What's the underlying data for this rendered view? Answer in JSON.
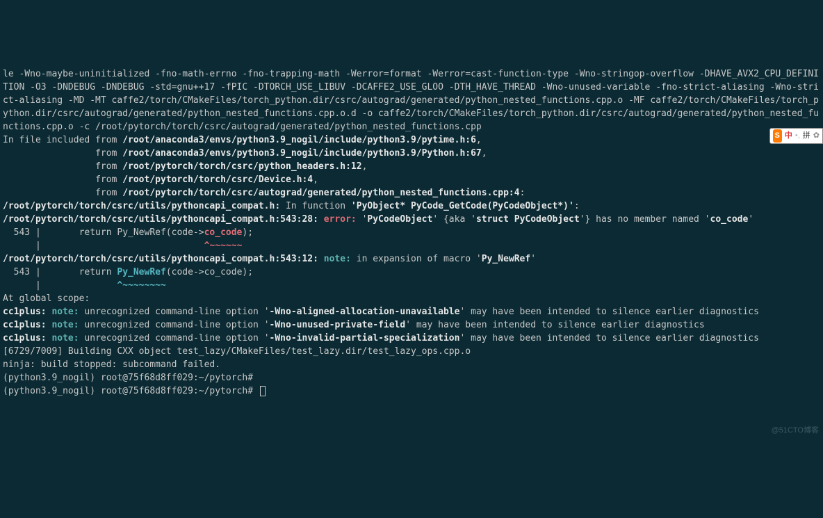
{
  "compile_flags": "le -Wno-maybe-uninitialized -fno-math-errno -fno-trapping-math -Werror=format -Werror=cast-function-type -Wno-stringop-overflow -DHAVE_AVX2_CPU_DEFINITION -O3 -DNDEBUG -DNDEBUG -std=gnu++17 -fPIC -DTORCH_USE_LIBUV -DCAFFE2_USE_GLOO -DTH_HAVE_THREAD -Wno-unused-variable -fno-strict-aliasing -Wno-strict-aliasing -MD -MT caffe2/torch/CMakeFiles/torch_python.dir/csrc/autograd/generated/python_nested_functions.cpp.o -MF caffe2/torch/CMakeFiles/torch_python.dir/csrc/autograd/generated/python_nested_functions.cpp.o.d -o caffe2/torch/CMakeFiles/torch_python.dir/csrc/autograd/generated/python_nested_functions.cpp.o -c /root/pytorch/torch/csrc/autograd/generated/python_nested_functions.cpp",
  "inc0_pre": "In file included from ",
  "inc0_path": "/root/anaconda3/envs/python3.9_nogil/include/python3.9/pytime.h:6",
  "inc_from": "                 from ",
  "inc1_path": "/root/anaconda3/envs/python3.9_nogil/include/python3.9/Python.h:67",
  "inc2_path": "/root/pytorch/torch/csrc/python_headers.h:12",
  "inc3_path": "/root/pytorch/torch/csrc/Device.h:4",
  "inc4_path": "/root/pytorch/torch/csrc/autograd/generated/python_nested_functions.cpp:4",
  "inc_colon": ":",
  "inc_comma": ",",
  "loc1_file": "/root/pytorch/torch/csrc/utils/pythoncapi_compat.h:",
  "loc1_infunc": " In function ",
  "loc1_sig": "'PyObject* PyCode_GetCode(PyCodeObject*)'",
  "err_file": "/root/pytorch/torch/csrc/utils/pythoncapi_compat.h:543:28:",
  "err_tag": " error: ",
  "err_msg1": "'",
  "err_type1": "PyCodeObject",
  "err_msg2": "' {aka '",
  "err_type2": "struct PyCodeObject",
  "err_msg3": "'} has no member named '",
  "err_member": "co_code",
  "err_msg4": "'",
  "code_ln": "  543 |       return Py_NewRef(code->",
  "code_mem": "co_code",
  "code_end": ");",
  "caret1": "      |                              ",
  "caret1b": "^~~~~~~",
  "note_file": "/root/pytorch/torch/csrc/utils/pythoncapi_compat.h:543:12:",
  "note_tag": " note: ",
  "note_msg": "in expansion of macro '",
  "note_macro": "Py_NewRef",
  "note_msg2": "'",
  "code2_ln": "  543 |       return ",
  "code2_macro": "Py_NewRef",
  "code2_rest": "(code->co_code);",
  "caret2": "      |              ",
  "caret2b": "^~~~~~~~~",
  "global_scope": "At global scope:",
  "cc1": "cc1plus: ",
  "cc_note": "note:",
  "cc_msg1a": " unrecognized command-line option '",
  "cc_opt1": "-Wno-aligned-allocation-unavailable",
  "cc_msg1b": "' may have been intended to silence earlier diagnostics",
  "cc_opt2": "-Wno-unused-private-field",
  "cc_opt3": "-Wno-invalid-partial-specialization",
  "build_line": "[6729/7009] Building CXX object test_lazy/CMakeFiles/test_lazy.dir/test_lazy_ops.cpp.o",
  "ninja": "ninja: build stopped: subcommand failed.",
  "prompt": "(python3.9_nogil) root@75f68d8ff029:~/pytorch#",
  "ime_s": "S",
  "ime_cn": "中",
  "ime_sep": "•,",
  "ime_pin": "拼",
  "ime_gear": "✿",
  "watermark": "@51CTO博客"
}
